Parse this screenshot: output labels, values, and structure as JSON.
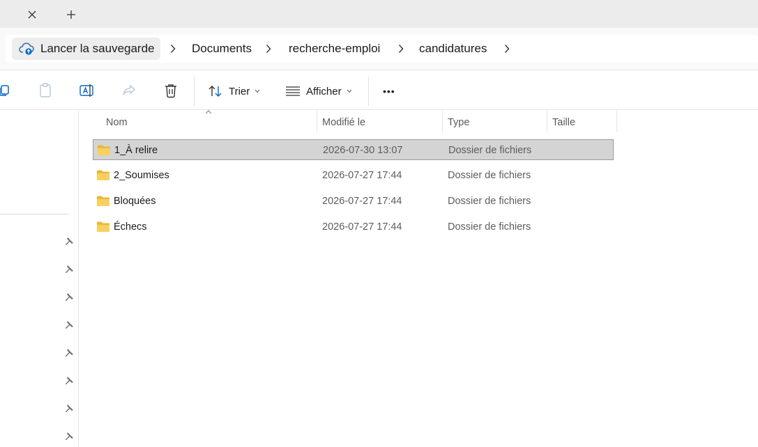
{
  "tabbar": {
    "close_icon": "close-icon",
    "new_tab_icon": "plus-icon"
  },
  "address": {
    "backup_label": "Lancer la sauvegarde",
    "crumbs": [
      "Documents",
      "recherche-emploi",
      "candidatures"
    ]
  },
  "toolbar": {
    "sort_label": "Trier",
    "view_label": "Afficher",
    "more_label": "•••"
  },
  "columns": {
    "name": "Nom",
    "modified": "Modifié le",
    "type": "Type",
    "size": "Taille"
  },
  "rows": [
    {
      "name": "1_À relire",
      "modified": "2026-07-30 13:07",
      "type": "Dossier de fichiers",
      "size": ""
    },
    {
      "name": "2_Soumises",
      "modified": "2026-07-27 17:44",
      "type": "Dossier de fichiers",
      "size": ""
    },
    {
      "name": "Bloquées",
      "modified": "2026-07-27 17:44",
      "type": "Dossier de fichiers",
      "size": ""
    },
    {
      "name": "Échecs",
      "modified": "2026-07-27 17:44",
      "type": "Dossier de fichiers",
      "size": ""
    }
  ],
  "colors": {
    "folder": "#f4c542",
    "selection": "#d4d4d4",
    "accent": "#0067c0"
  }
}
